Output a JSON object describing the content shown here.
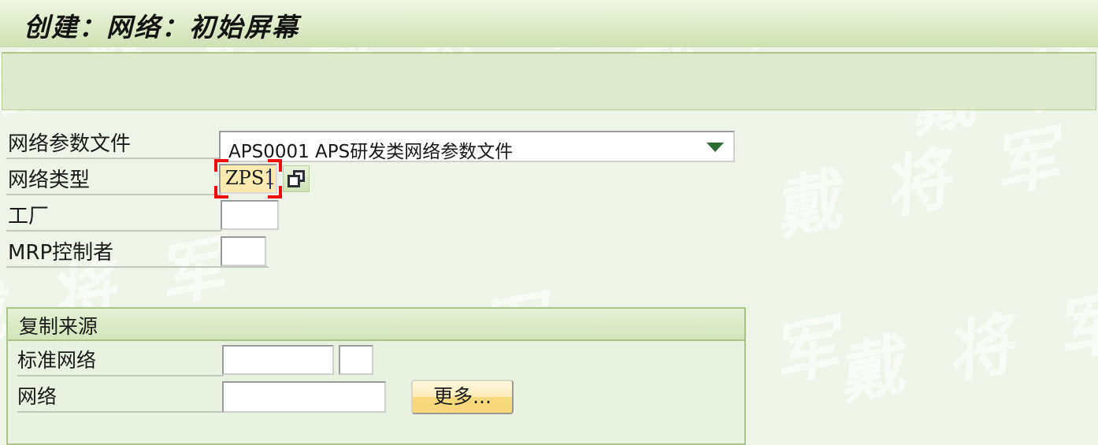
{
  "window": {
    "title": "创建：网络：初始屏幕"
  },
  "watermark": {
    "text": "戴 将 军"
  },
  "colors": {
    "page_background": "#eff4e9",
    "title_bar": "#cfe0b4",
    "group_header": "#d2e4b9",
    "focus_field_background": "#fbe9b0",
    "focus_marker": "#ee0c0c",
    "button_accent": "#f6d87a",
    "dropdown_arrow": "#2f6b34"
  },
  "form": {
    "fields": [
      {
        "label": "网络参数文件",
        "type": "dropdown",
        "value": "APS0001 APS研发类网络参数文件",
        "arrow_icon": "chevron-down-icon"
      },
      {
        "label": "网络类型",
        "type": "text-focused",
        "value": "ZPS1",
        "matchcode_icon": "matchcode-overlapping-squares-icon"
      },
      {
        "label": "工厂",
        "type": "text",
        "value": ""
      },
      {
        "label": "MRP控制者",
        "type": "text",
        "value": ""
      }
    ]
  },
  "groupbox": {
    "title": "复制来源",
    "fields": [
      {
        "label": "标准网络",
        "type": "text-pair",
        "value": "",
        "value2": ""
      },
      {
        "label": "网络",
        "type": "text",
        "value": ""
      }
    ],
    "more_button": {
      "label": "更多..."
    }
  }
}
